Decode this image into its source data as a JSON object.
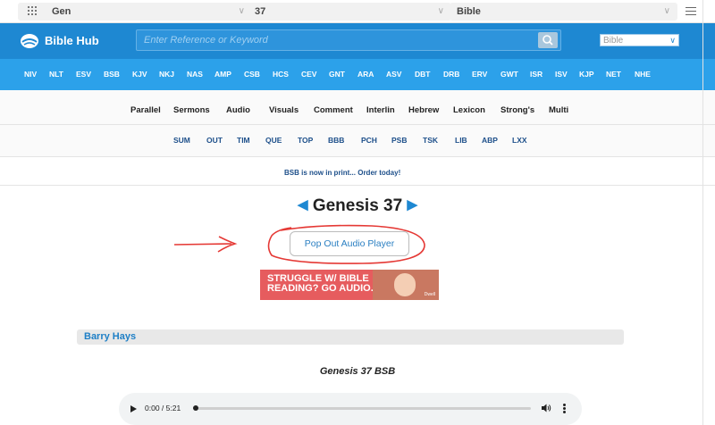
{
  "selectors": {
    "book": "Gen",
    "chapter": "37",
    "resource": "Bible"
  },
  "header": {
    "site_name": "Bible Hub",
    "search_placeholder": "Enter Reference or Keyword",
    "version_select": "Bible"
  },
  "versions": [
    "NIV",
    "NLT",
    "ESV",
    "BSB",
    "KJV",
    "NKJ",
    "NAS",
    "AMP",
    "CSB",
    "HCS",
    "CEV",
    "GNT",
    "ARA",
    "ASV",
    "DBT",
    "DRB",
    "ERV",
    "GWT",
    "ISR",
    "ISV",
    "KJP",
    "NET",
    "NHE"
  ],
  "nav_main": [
    "Parallel",
    "Sermons",
    "Audio",
    "Visuals",
    "Comment",
    "Interlin",
    "Hebrew",
    "Lexicon",
    "Strong's",
    "Multi"
  ],
  "nav_secondary": [
    "SUM",
    "OUT",
    "TIM",
    "QUE",
    "TOP",
    "BBB",
    "PCH",
    "PSB",
    "TSK",
    "LIB",
    "ABP",
    "LXX"
  ],
  "notice": "BSB is now in print... Order today!",
  "chapter": {
    "title": "Genesis 37",
    "prev_arrow": "◀",
    "next_arrow": "▶"
  },
  "popout_label": "Pop Out Audio Player",
  "banner": {
    "line1": "STRUGGLE W/ BIBLE",
    "line2": "READING? GO AUDIO.",
    "tag": "Dwell"
  },
  "commentator": "Barry Hays",
  "audio": {
    "title": "Genesis 37 BSB",
    "time": "0:00 / 5:21",
    "progress": 0.0
  },
  "annotation": {
    "color": "#e53935"
  },
  "colors": {
    "brand": "#1e88d2",
    "versions_bar": "#2ca1ea"
  }
}
